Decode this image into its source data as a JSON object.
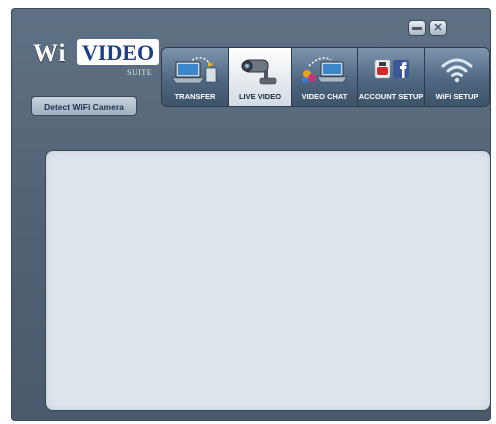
{
  "app": {
    "logo_wi": "Wi",
    "logo_video": "VIDEO",
    "logo_suite": "SUITE"
  },
  "sidebar": {
    "detect_button": "Detect WiFi Camera"
  },
  "window_controls": {
    "minimize_icon": "minimize-icon",
    "close_icon": "close-icon",
    "close_glyph": "✕"
  },
  "tabs": [
    {
      "label": "TRANSFER",
      "icon": "laptop-transfer-icon",
      "active": false
    },
    {
      "label": "LIVE VIDEO",
      "icon": "camera-icon",
      "active": true
    },
    {
      "label": "VIDEO CHAT",
      "icon": "video-chat-icon",
      "active": false
    },
    {
      "label": "ACCOUNT SETUP",
      "icon": "youtube-facebook-icon",
      "active": false
    },
    {
      "label": "WiFi SETUP",
      "icon": "wifi-icon",
      "active": false
    }
  ],
  "colors": {
    "window_bg": "#55677a",
    "panel_bg": "#dde4ec",
    "logo_blue": "#1e3f86",
    "facebook_blue": "#3b5998",
    "youtube_red": "#d22a2a"
  }
}
